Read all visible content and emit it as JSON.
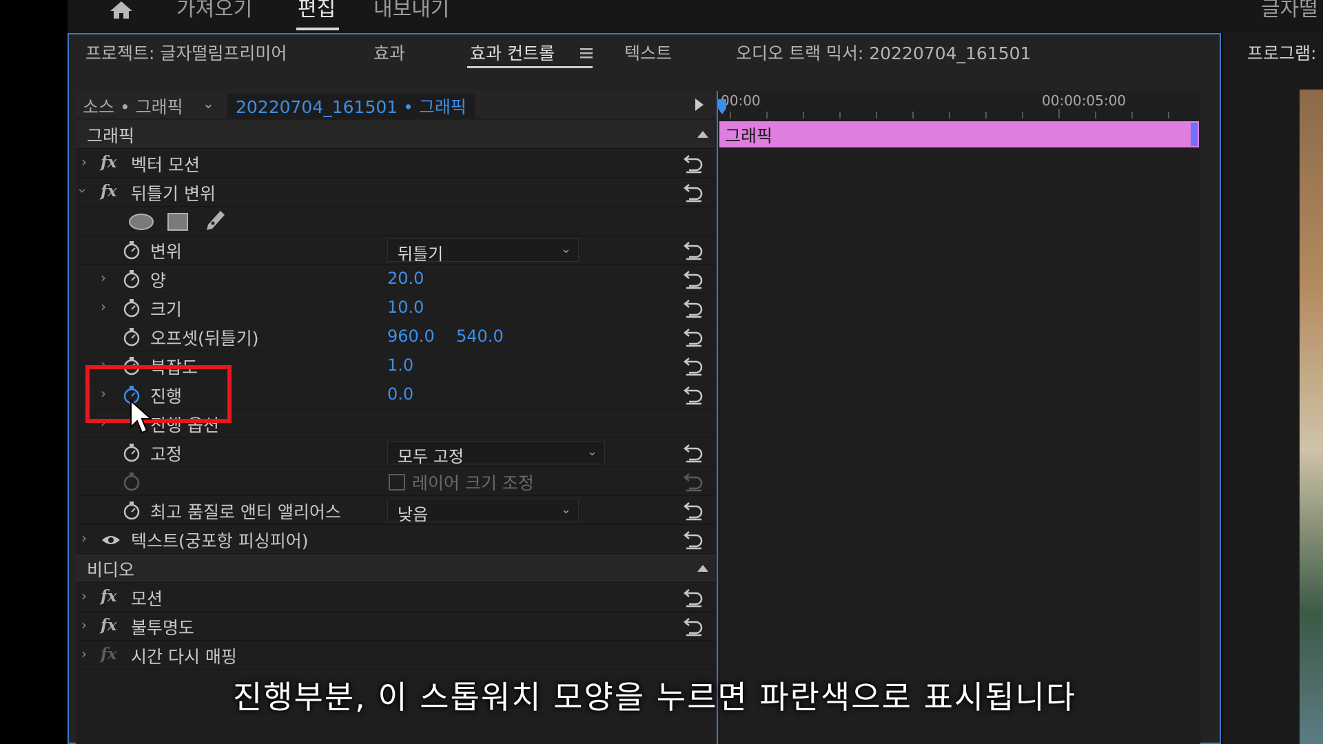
{
  "workspace": {
    "tabs": [
      "가져오기",
      "편집",
      "내보내기"
    ],
    "active": "편집",
    "right_label": "글자떨"
  },
  "panel_tabs": [
    {
      "label": "프로젝트: 글자떨림프리미어",
      "active": false
    },
    {
      "label": "효과",
      "active": false
    },
    {
      "label": "효과 컨트롤",
      "active": true
    },
    {
      "label": "텍스트",
      "active": false
    },
    {
      "label": "오디오 트랙 믹서: 20220704_161501",
      "active": false
    }
  ],
  "panel_menu_icon": "hamburger-menu-icon",
  "right_panel_title": "프로그램:",
  "source": {
    "label": "소스 • 그래픽",
    "sequence": "20220704_161501 • 그래픽"
  },
  "timeline": {
    "start": "00:00",
    "mark": "00:00:05:00",
    "clip_label": "그래픽"
  },
  "sections": {
    "graphic": "그래픽",
    "video": "비디오"
  },
  "effects": {
    "vector_motion": "벡터 모션",
    "warp": "뒤틀기 변위",
    "displacement": "변위",
    "displacement_value": "뒤틀기",
    "amount": "양",
    "amount_value": "20.0",
    "size": "크기",
    "size_value": "10.0",
    "offset": "오프셋(뒤틀기)",
    "offset_x": "960.0",
    "offset_y": "540.0",
    "complexity": "복잡도",
    "complexity_value": "1.0",
    "evolution": "진행",
    "evolution_value": "0.0",
    "evolution_options": "진행 옵션",
    "pin": "고정",
    "pin_value": "모두 고정",
    "resize_layer": "레이어 크기 조정",
    "antialias": "최고 품질로 앤티 앨리어스",
    "antialias_value": "낮음",
    "text_layer": "텍스트(궁포항 피싱피어)",
    "motion": "모션",
    "opacity": "불투명도",
    "time_remap": "시간 다시 매핑"
  },
  "subtitle": "진행부분, 이 스톱워치 모양을 누르면 파란색으로 표시됩니다",
  "colors": {
    "accent_blue": "#3d8ee8",
    "clip_pink": "#e07ee0",
    "highlight_red": "#e8161d"
  }
}
